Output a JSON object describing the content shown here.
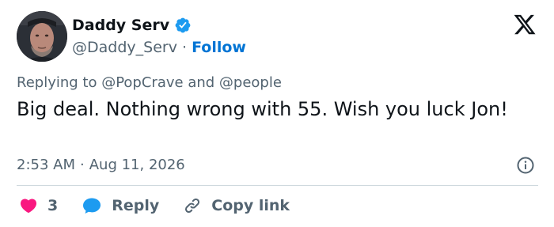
{
  "author": {
    "display_name": "Daddy Serv",
    "handle": "@Daddy_Serv",
    "separator": " · ",
    "follow_label": "Follow",
    "verified": true
  },
  "replying": {
    "prefix": "Replying to ",
    "mention_1": "@PopCrave",
    "conjunction": " and ",
    "mention_2": "@people"
  },
  "tweet": {
    "text": "Big deal. Nothing wrong with 55. Wish you luck Jon!",
    "time": "2:53 AM",
    "date_separator": "·",
    "date": "Aug 11, 2026"
  },
  "actions": {
    "like_count": "3",
    "reply_label": "Reply",
    "copy_label": "Copy link"
  },
  "icons": {
    "logo": "x-logo-icon",
    "verified": "verified-badge-icon",
    "info": "info-icon",
    "like": "heart-icon",
    "reply": "speech-bubble-icon",
    "copy": "link-icon"
  },
  "colors": {
    "link_blue": "#0074d4",
    "verified_blue": "#1d9bf0",
    "heart_pink": "#f91880",
    "secondary_text": "#536471",
    "primary_text": "#0f1419",
    "divider": "#cfd9de"
  }
}
